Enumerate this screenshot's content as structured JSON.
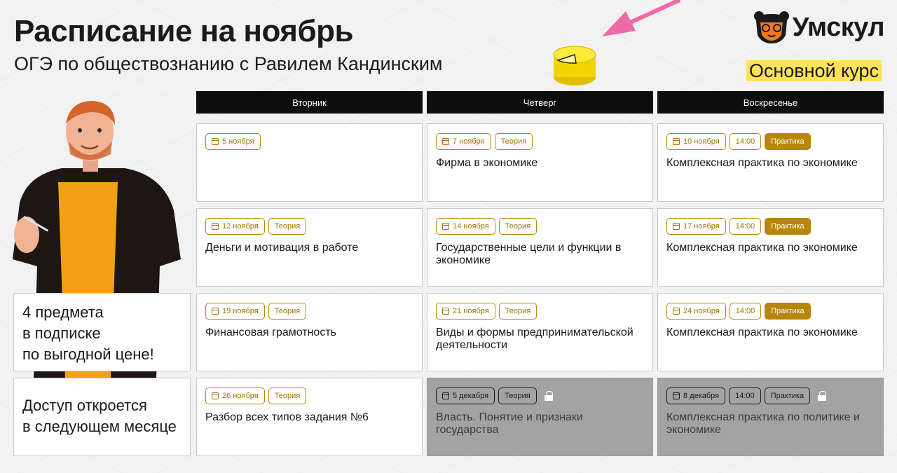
{
  "header": {
    "title": "Расписание на ноябрь",
    "subtitle": "ОГЭ по обществознанию с Равилем Кандинским"
  },
  "brand": {
    "logo_text": "Умскул",
    "course_badge": "Основной курс",
    "accent": "#b8860b",
    "highlight": "#ffe25a"
  },
  "days": [
    "Вторник",
    "Четверг",
    "Воскресенье"
  ],
  "side": {
    "promo_line1": "4 предмета",
    "promo_line2": "в подписке",
    "promo_line3": "по выгодной цене!",
    "locked_line1": "Доступ откроется",
    "locked_line2": "в следующем месяце"
  },
  "rows": [
    [
      {
        "date": "5 ноября",
        "type": "",
        "time": "",
        "title": ""
      },
      {
        "date": "7 ноября",
        "type": "Теория",
        "time": "",
        "title": "Фирма в экономике"
      },
      {
        "date": "10 ноября",
        "type": "Практика",
        "time": "14:00",
        "title": "Комплексная практика по экономике"
      }
    ],
    [
      {
        "date": "12 ноября",
        "type": "Теория",
        "time": "",
        "title": "Деньги и мотивация в работе"
      },
      {
        "date": "14 ноября",
        "type": "Теория",
        "time": "",
        "title": "Государственные цели и функции в экономике"
      },
      {
        "date": "17 ноября",
        "type": "Практика",
        "time": "14:00",
        "title": "Комплексная практика по экономике"
      }
    ],
    [
      {
        "date": "19 ноября",
        "type": "Теория",
        "time": "",
        "title": "Финансовая грамотность"
      },
      {
        "date": "21 ноября",
        "type": "Теория",
        "time": "",
        "title": "Виды и формы предпринимательской деятельности"
      },
      {
        "date": "24 ноября",
        "type": "Практика",
        "time": "14:00",
        "title": "Комплексная практика по экономике"
      }
    ],
    [
      {
        "date": "26 ноября",
        "type": "Теория",
        "time": "",
        "title": "Разбор всех типов задания №6"
      },
      {
        "date": "5 декабря",
        "type": "Теория",
        "time": "",
        "title": "Власть. Понятие и признаки государства",
        "locked": true
      },
      {
        "date": "8 декабря",
        "type": "Практика",
        "time": "14:00",
        "title": "Комплексная практика по политике и экономике",
        "locked": true
      }
    ]
  ]
}
